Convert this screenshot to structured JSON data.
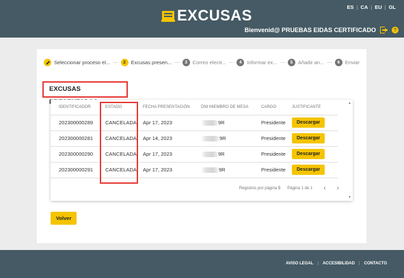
{
  "header": {
    "logo_text": "EXCUSAS",
    "languages": [
      "ES",
      "CA",
      "EU",
      "GL"
    ],
    "user_greeting": "Bienvenid@ PRUEBAS EIDAS CERTIFICADO",
    "help_label": "?"
  },
  "stepper": {
    "steps": [
      {
        "label": "Seleccionar proceso el...",
        "number": "",
        "state": "done"
      },
      {
        "label": "Excusas presen...",
        "number": "2",
        "state": "active"
      },
      {
        "label": "Correo electr...",
        "number": "3",
        "state": "pending"
      },
      {
        "label": "Informar ex...",
        "number": "4",
        "state": "pending"
      },
      {
        "label": "Añadir an...",
        "number": "5",
        "state": "pending"
      },
      {
        "label": "Enviar",
        "number": "6",
        "state": "pending"
      }
    ]
  },
  "section_title": "EXCUSAS PRESENTADAS",
  "table": {
    "headers": [
      "IDENTIFICADOR",
      "ESTADO",
      "FECHA PRESENTACIÓN",
      "DNI MIEMBRO DE MESA",
      "CARGO",
      "JUSTIFICANTE"
    ],
    "rows": [
      {
        "id": "202300000289",
        "estado": "CANCELADA",
        "fecha": "Apr 17, 2023",
        "dni": "9R",
        "cargo": "Presidente",
        "justificante": "Descargar"
      },
      {
        "id": "202300000281",
        "estado": "CANCELADA",
        "fecha": "Apr 14, 2023",
        "dni": "9R",
        "cargo": "Presidente",
        "justificante": "Descargar"
      },
      {
        "id": "202300000290",
        "estado": "CANCELADA",
        "fecha": "Apr 17, 2023",
        "dni": "9R",
        "cargo": "Presidente",
        "justificante": "Descargar"
      },
      {
        "id": "202300000291",
        "estado": "CANCELADA",
        "fecha": "Apr 17, 2023",
        "dni": "9R",
        "cargo": "Presidente",
        "justificante": "Descargar"
      }
    ],
    "pager": {
      "rows_per_page_label": "Registros por página",
      "rows_per_page_value": "5",
      "page_info": "Página 1 de 1",
      "prev_icon": "‹",
      "next_icon": "›"
    }
  },
  "back_button": "Volver",
  "footer": {
    "links": [
      "AVISO LEGAL",
      "ACCESIBILIDAD",
      "CONTACTO"
    ]
  },
  "colors": {
    "header_bg": "#455a64",
    "accent": "#f5c400",
    "highlight": "#e53935"
  }
}
